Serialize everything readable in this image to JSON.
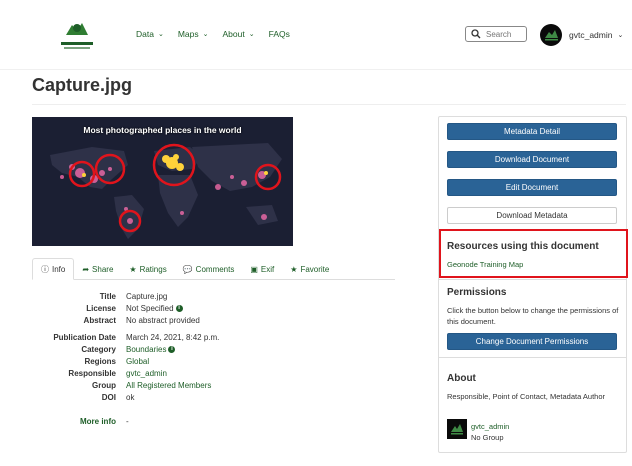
{
  "nav": {
    "logo_icon": "gvtc-logo",
    "items": [
      {
        "label": "Data",
        "has_caret": true
      },
      {
        "label": "Maps",
        "has_caret": true
      },
      {
        "label": "About",
        "has_caret": true
      },
      {
        "label": "FAQs",
        "has_caret": false
      }
    ],
    "search_placeholder": "Search",
    "user": "gvtc_admin"
  },
  "page_title": "Capture.jpg",
  "image": {
    "caption": "Most photographed places in the world"
  },
  "tabs": [
    {
      "label": "Info",
      "icon": "info-icon",
      "active": true
    },
    {
      "label": "Share",
      "icon": "share-icon",
      "active": false
    },
    {
      "label": "Ratings",
      "icon": "star-icon",
      "active": false
    },
    {
      "label": "Comments",
      "icon": "comments-icon",
      "active": false
    },
    {
      "label": "Exif",
      "icon": "image-icon",
      "active": false
    },
    {
      "label": "Favorite",
      "icon": "star-icon",
      "active": false
    }
  ],
  "info": {
    "title_k": "Title",
    "title_v": "Capture.jpg",
    "license_k": "License",
    "license_v": "Not Specified",
    "abstract_k": "Abstract",
    "abstract_v": "No abstract provided",
    "pubdate_k": "Publication Date",
    "pubdate_v": "March 24, 2021, 8:42 p.m.",
    "category_k": "Category",
    "category_v": "Boundaries",
    "regions_k": "Regions",
    "regions_v": "Global",
    "responsible_k": "Responsible",
    "responsible_v": "gvtc_admin",
    "group_k": "Group",
    "group_v": "All Registered Members",
    "doi_k": "DOI",
    "doi_v": "ok",
    "more_k": "More info",
    "more_v": "-"
  },
  "panel": {
    "metadata_detail": "Metadata Detail",
    "download_document": "Download Document",
    "edit_document": "Edit Document",
    "download_metadata": "Download Metadata",
    "resources_title": "Resources using this document",
    "resources_link": "Geonode Training Map",
    "permissions_title": "Permissions",
    "permissions_text": "Click the button below to change the permissions of this document.",
    "change_permissions": "Change Document Permissions",
    "about_title": "About",
    "about_text": "Responsible, Point of Contact, Metadata Author",
    "about_user": "gvtc_admin",
    "about_group": "No Group"
  },
  "colors": {
    "brand_green": "#1e5e28",
    "button_blue": "#2a6396",
    "highlight_red": "#e0141c"
  }
}
